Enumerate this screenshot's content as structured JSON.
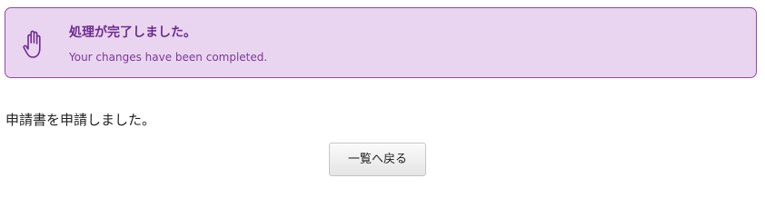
{
  "notice": {
    "icon": "raised-hand-icon",
    "title": "処理が完了しました。",
    "subtitle": "Your changes have been completed.",
    "colors": {
      "background": "#ead5f0",
      "border": "#8e4aa6",
      "title": "#6b2d8f"
    }
  },
  "main": {
    "message": "申請書を申請しました。",
    "back_button_label": "一覧へ戻る"
  }
}
